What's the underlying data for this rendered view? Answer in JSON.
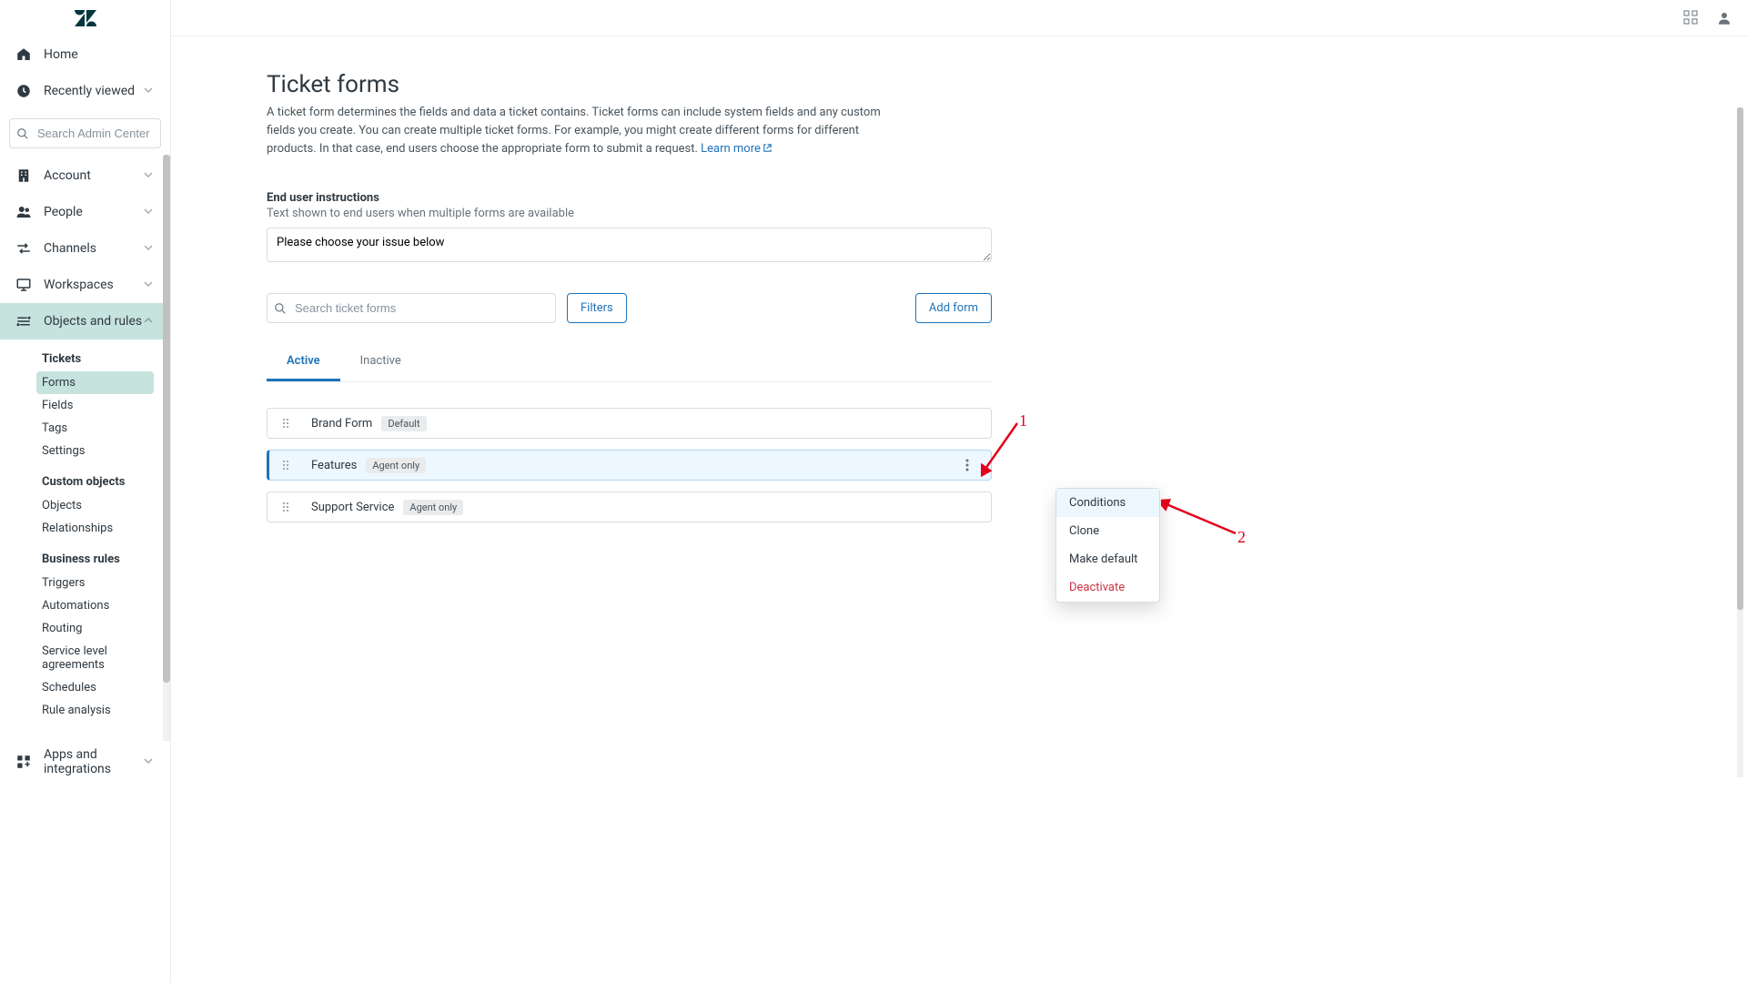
{
  "sidebar": {
    "home": "Home",
    "recently_viewed": "Recently viewed",
    "search_placeholder": "Search Admin Center",
    "sections": [
      {
        "label": "Account"
      },
      {
        "label": "People"
      },
      {
        "label": "Channels"
      },
      {
        "label": "Workspaces"
      },
      {
        "label": "Objects and rules"
      },
      {
        "label": "Apps and integrations"
      }
    ],
    "objects_and_rules": {
      "tickets": {
        "header": "Tickets",
        "items": [
          "Forms",
          "Fields",
          "Tags",
          "Settings"
        ]
      },
      "custom_objects": {
        "header": "Custom objects",
        "items": [
          "Objects",
          "Relationships"
        ]
      },
      "business_rules": {
        "header": "Business rules",
        "items": [
          "Triggers",
          "Automations",
          "Routing",
          "Service level agreements",
          "Schedules",
          "Rule analysis"
        ]
      }
    }
  },
  "page": {
    "title": "Ticket forms",
    "description": "A ticket form determines the fields and data a ticket contains. Ticket forms can include system fields and any custom fields you create. You can create multiple ticket forms. For example, you might create different forms for different products. In that case, end users choose the appropriate form to submit a request. ",
    "learn_more": "Learn more",
    "instructions_label": "End user instructions",
    "instructions_hint": "Text shown to end users when multiple forms are available",
    "instructions_value": "Please choose your issue below",
    "form_search_placeholder": "Search ticket forms",
    "filters_btn": "Filters",
    "add_form_btn": "Add form",
    "tabs": {
      "active": "Active",
      "inactive": "Inactive"
    }
  },
  "forms": [
    {
      "name": "Brand Form",
      "badge": "Default"
    },
    {
      "name": "Features",
      "badge": "Agent only"
    },
    {
      "name": "Support Service",
      "badge": "Agent only"
    }
  ],
  "dropdown": {
    "conditions": "Conditions",
    "clone": "Clone",
    "make_default": "Make default",
    "deactivate": "Deactivate"
  },
  "annotations": {
    "one": "1",
    "two": "2"
  }
}
